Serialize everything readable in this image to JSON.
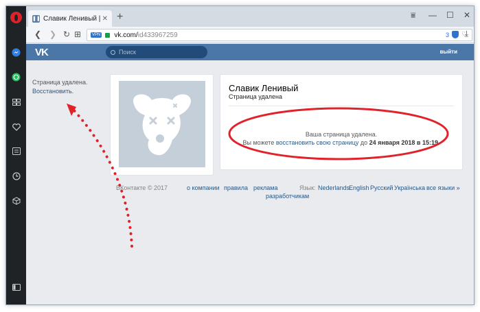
{
  "tab": {
    "title": "Славик Ленивый | ВКонтакте"
  },
  "address_bar": {
    "vpn_label": "VPN",
    "host": "vk.com/",
    "path": "id433967259",
    "adblock_count": "3"
  },
  "vk_header": {
    "logo": "VK",
    "search_placeholder": "Поиск",
    "logout": "выйти"
  },
  "left_panel": {
    "status": "Страница удалена.",
    "restore_link": "Восстановить."
  },
  "profile": {
    "name": "Славик Ленивый",
    "status": "Страница удалена",
    "deleted_title": "Ваша страница удалена.",
    "deleted_prefix": "Вы можете ",
    "restore_link": "восстановить свою страницу",
    "deleted_mid": " до ",
    "deadline": "24 января 2018 в 15:19",
    "deleted_end": "."
  },
  "footer": {
    "copyright": "ВКонтакте © 2017",
    "links": [
      "о компании",
      "правила",
      "реклама",
      "разработчикам"
    ],
    "lang_label": "Язык:",
    "languages": [
      "Nederlands",
      "English",
      "Русский",
      "Українська",
      "все языки »"
    ]
  },
  "colors": {
    "vk_blue": "#4a76a8",
    "annotation_red": "#e0222b",
    "link": "#2a5885"
  },
  "icons": [
    "opera-icon",
    "messenger-icon",
    "whatsapp-icon",
    "speed-dial-icon",
    "bookmarks-heart-icon",
    "news-icon",
    "history-icon",
    "extensions-cube-icon",
    "sidebar-toggle-icon"
  ]
}
